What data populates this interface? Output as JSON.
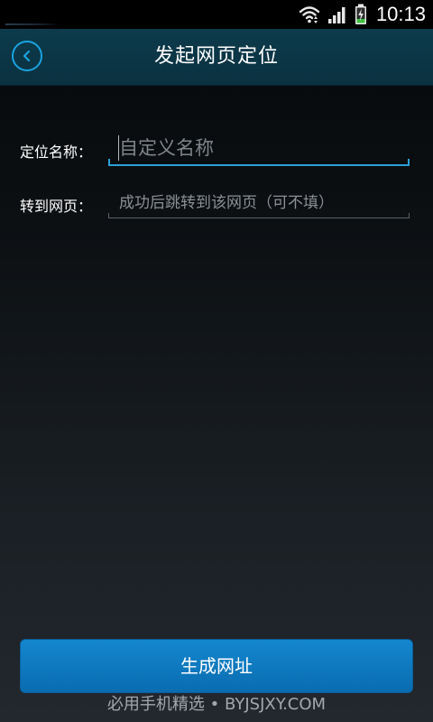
{
  "status_bar": {
    "time": "10:13",
    "icons": [
      "wifi-icon",
      "signal-icon",
      "battery-charging-icon"
    ]
  },
  "header": {
    "title": "发起网页定位",
    "back_icon": "chevron-left-circle-icon"
  },
  "form": {
    "name": {
      "label": "定位名称：",
      "value": "",
      "placeholder": "自定义名称"
    },
    "url": {
      "label": "转到网页：",
      "value": "",
      "placeholder": "成功后跳转到该网页（可不填）"
    }
  },
  "actions": {
    "generate_label": "生成网址"
  },
  "watermark": "必用手机精选 • BYJSJXY.COM",
  "colors": {
    "accent": "#1aa3e0",
    "button": "#1487cf",
    "title_bar": "#0d3b4c"
  }
}
